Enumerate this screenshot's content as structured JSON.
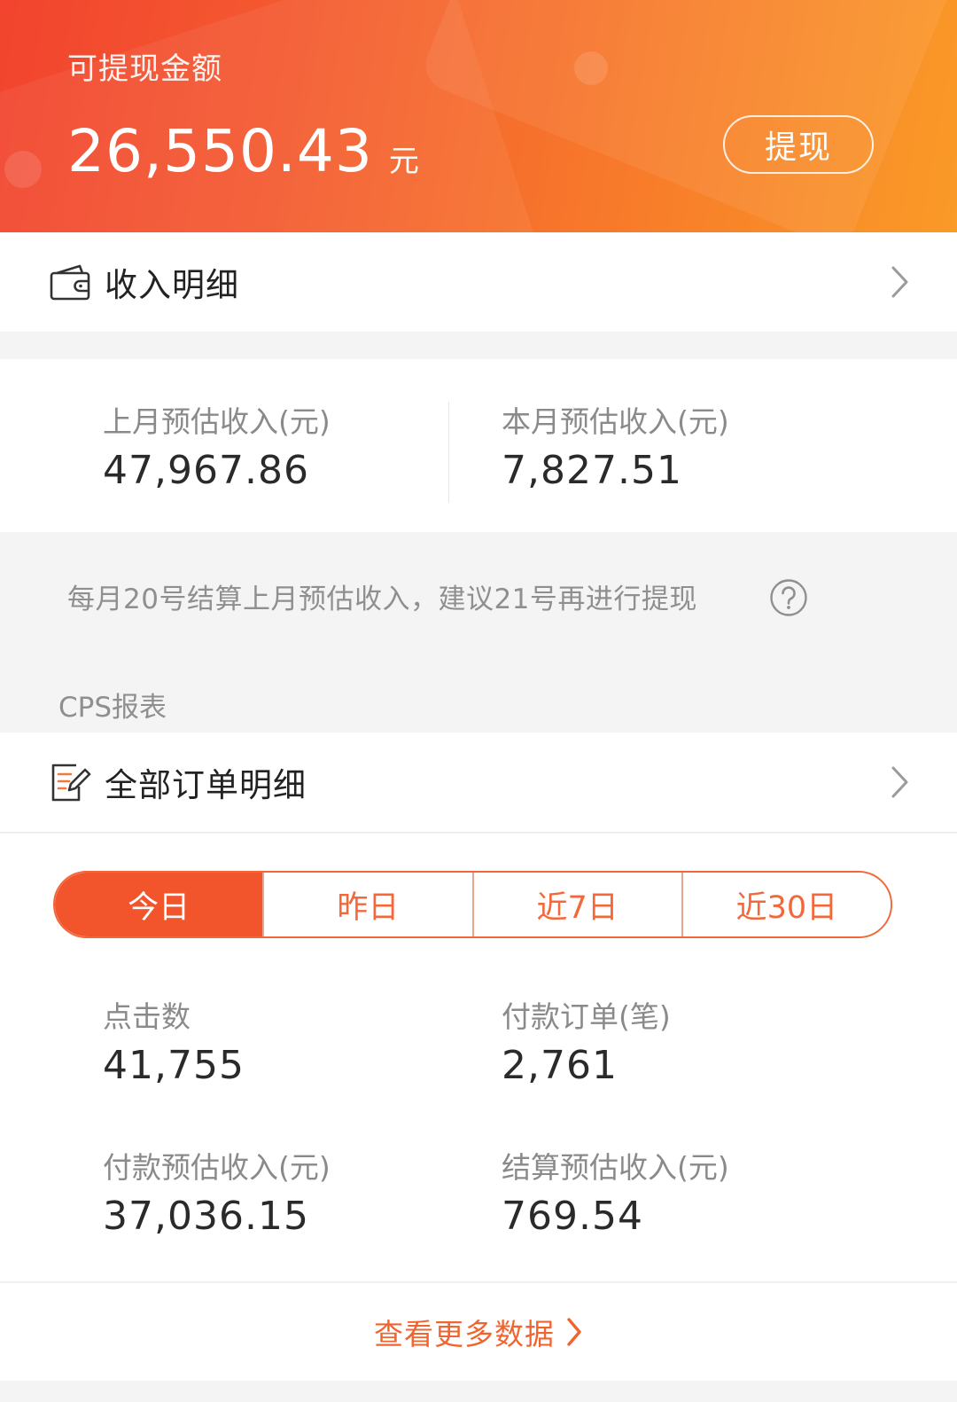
{
  "header": {
    "balance_label": "可提现金额",
    "balance_value": "26,550.43",
    "balance_unit": "元",
    "withdraw_label": "提现"
  },
  "income_detail": {
    "label": "收入明细",
    "icon": "wallet-icon"
  },
  "month": {
    "last_label": "上月预估收入(元)",
    "last_value": "47,967.86",
    "this_label": "本月预估收入(元)",
    "this_value": "7,827.51"
  },
  "notice": "每月20号结算上月预估收入，建议21号再进行提现",
  "cps": {
    "section_title": "CPS报表",
    "orders_label": "全部订单明细",
    "tabs": [
      "今日",
      "昨日",
      "近7日",
      "近30日"
    ],
    "active_tab": 0,
    "stats": {
      "clicks_label": "点击数",
      "clicks_value": "41,755",
      "paid_orders_label": "付款订单(笔)",
      "paid_orders_value": "2,761",
      "paid_income_label": "付款预估收入(元)",
      "paid_income_value": "37,036.15",
      "settled_income_label": "结算预估收入(元)",
      "settled_income_value": "769.54"
    },
    "more_label": "查看更多数据"
  },
  "colors": {
    "accent": "#f2552c",
    "header_start": "#f2442e",
    "header_end": "#fa9a27"
  }
}
